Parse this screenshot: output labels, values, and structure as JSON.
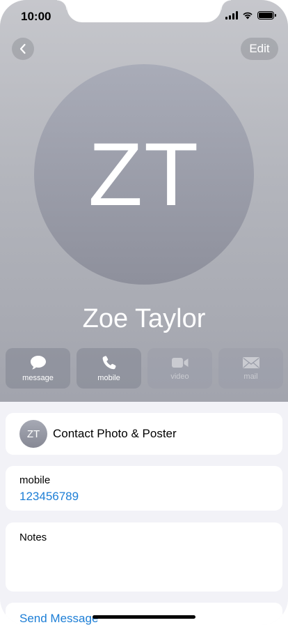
{
  "status_bar": {
    "time": "10:00"
  },
  "header": {
    "edit_label": "Edit"
  },
  "contact": {
    "initials": "ZT",
    "name": "Zoe Taylor"
  },
  "actions": [
    {
      "label": "message",
      "icon": "message-bubble-icon",
      "enabled": true
    },
    {
      "label": "mobile",
      "icon": "phone-icon",
      "enabled": true
    },
    {
      "label": "video",
      "icon": "video-camera-icon",
      "enabled": false
    },
    {
      "label": "mail",
      "icon": "mail-envelope-icon",
      "enabled": false
    }
  ],
  "photo_card": {
    "initials": "ZT",
    "label": "Contact Photo & Poster"
  },
  "phone_card": {
    "label": "mobile",
    "number": "123456789"
  },
  "notes_card": {
    "label": "Notes"
  },
  "send_card": {
    "label": "Send Message"
  },
  "colors": {
    "accent": "#1c7ed6",
    "hero_top": "#c6c7cc",
    "hero_bottom": "#a2a4ad"
  }
}
